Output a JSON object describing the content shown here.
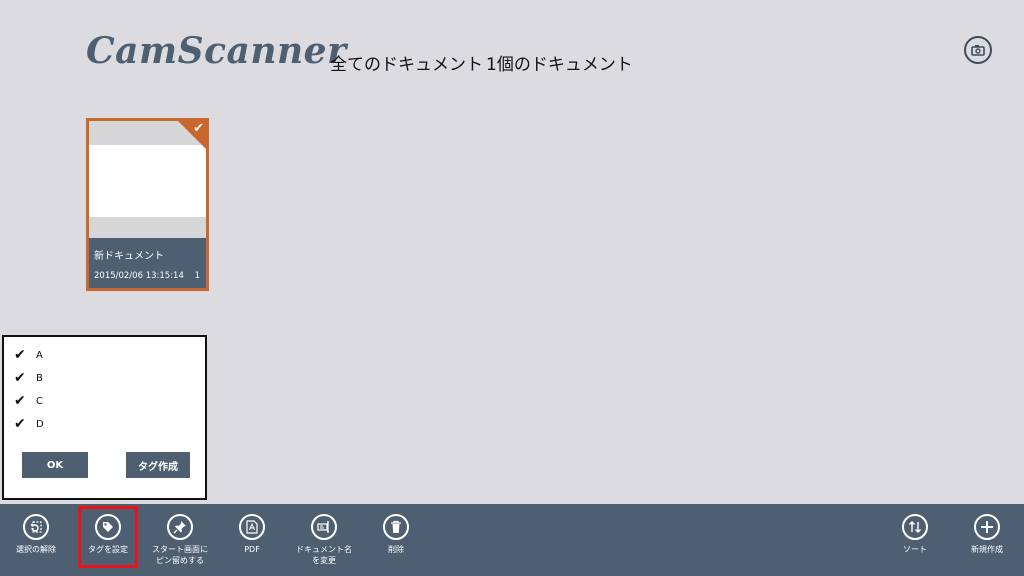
{
  "header": {
    "logo": "CamScanner",
    "title": "全てのドキュメント",
    "count": "1個のドキュメント"
  },
  "document": {
    "name": "新ドキュメント",
    "date": "2015/02/06 13:15:14",
    "pages": "1",
    "selected": true
  },
  "tag_popup": {
    "tags": [
      {
        "label": "A",
        "checked": true
      },
      {
        "label": "B",
        "checked": true
      },
      {
        "label": "C",
        "checked": true
      },
      {
        "label": "D",
        "checked": true
      }
    ],
    "ok_label": "OK",
    "create_label": "タグ作成"
  },
  "appbar": {
    "deselect": "選択の解除",
    "set_tag": "タグを設定",
    "pin_start": "スタート画面に\nピン留めする",
    "pdf": "PDF",
    "rename": "ドキュメント名\nを変更",
    "delete": "削除",
    "sort": "ソート",
    "new": "新規作成"
  },
  "colors": {
    "background": "#dcdce0",
    "appbar": "#4e5f71",
    "accent": "#c8682f",
    "highlight": "#e8141a"
  }
}
